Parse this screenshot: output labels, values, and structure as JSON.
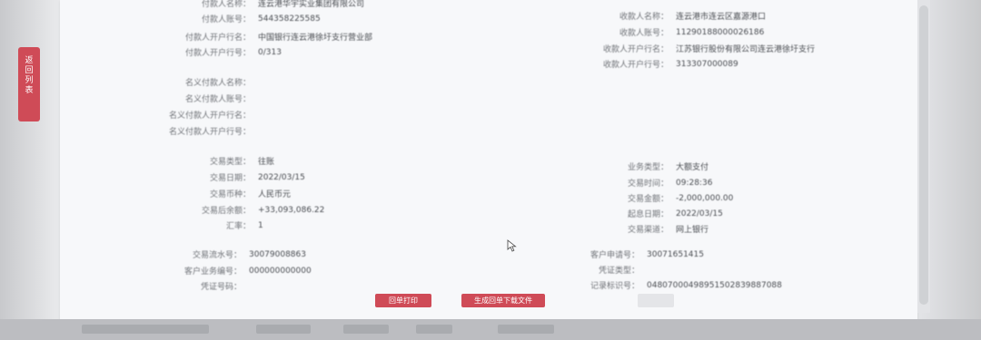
{
  "side_tab": {
    "chars": [
      "返",
      "回",
      "列",
      "表"
    ]
  },
  "payer": {
    "name_label": "付款人名称：",
    "name_value": "连云港华宇实业集团有限公司",
    "account_label": "付款人账号：",
    "account_value": "544358225585",
    "bank_label": "付款人开户行名：",
    "bank_value": "中国银行连云港徐圩支行营业部",
    "bank_no_label": "付款人开户行号：",
    "bank_no_value": "0/313"
  },
  "payee": {
    "name_label": "收款人名称：",
    "name_value": "连云港市连云区嘉源港口",
    "account_label": "收款人账号：",
    "account_value": "11290188000026186",
    "bank_label": "收款人开户行名：",
    "bank_value": "江苏银行股份有限公司连云港徐圩支行",
    "bank_no_label": "收款人开户行号：",
    "bank_no_value": "313307000089"
  },
  "nominal": {
    "payer_name_label": "名义付款人名称：",
    "payer_account_label": "名义付款人账号：",
    "payer_bank_label": "名义付款人开户行名：",
    "payer_bank_no_label": "名义付款人开户行号："
  },
  "trade": {
    "type_label": "交易类型：",
    "type_value": "往账",
    "date_label": "交易日期：",
    "date_value": "2022/03/15",
    "currency_label": "交易币种：",
    "currency_value": "人民币元",
    "balance_label": "交易后余额：",
    "balance_value": "+33,093,086.22",
    "rate_label": "汇率：",
    "rate_value": "1",
    "biz_type_label": "业务类型：",
    "biz_type_value": "大额支付",
    "time_label": "交易时间：",
    "time_value": "09:28:36",
    "amount_label": "交易金额：",
    "amount_value": "-2,000,000.00",
    "value_date_label": "起息日期：",
    "value_date_value": "2022/03/15",
    "channel_label": "交易渠道：",
    "channel_value": "网上银行"
  },
  "extra": {
    "serial_label": "交易流水号：",
    "serial_value": "30079008863",
    "biz_no_label": "客户业务编号：",
    "biz_no_value": "000000000000",
    "voucher_no_label": "凭证号码：",
    "voucher_no_value": "",
    "apply_no_label": "客户申请号：",
    "apply_no_value": "30071651415",
    "voucher_type_label": "凭证类型：",
    "voucher_type_value": "",
    "record_id_label": "记录标识号：",
    "record_id_value": "04807000498951502839887088"
  },
  "buttons": {
    "print_label": "回单打印",
    "download_label": "生成回单下载文件"
  }
}
